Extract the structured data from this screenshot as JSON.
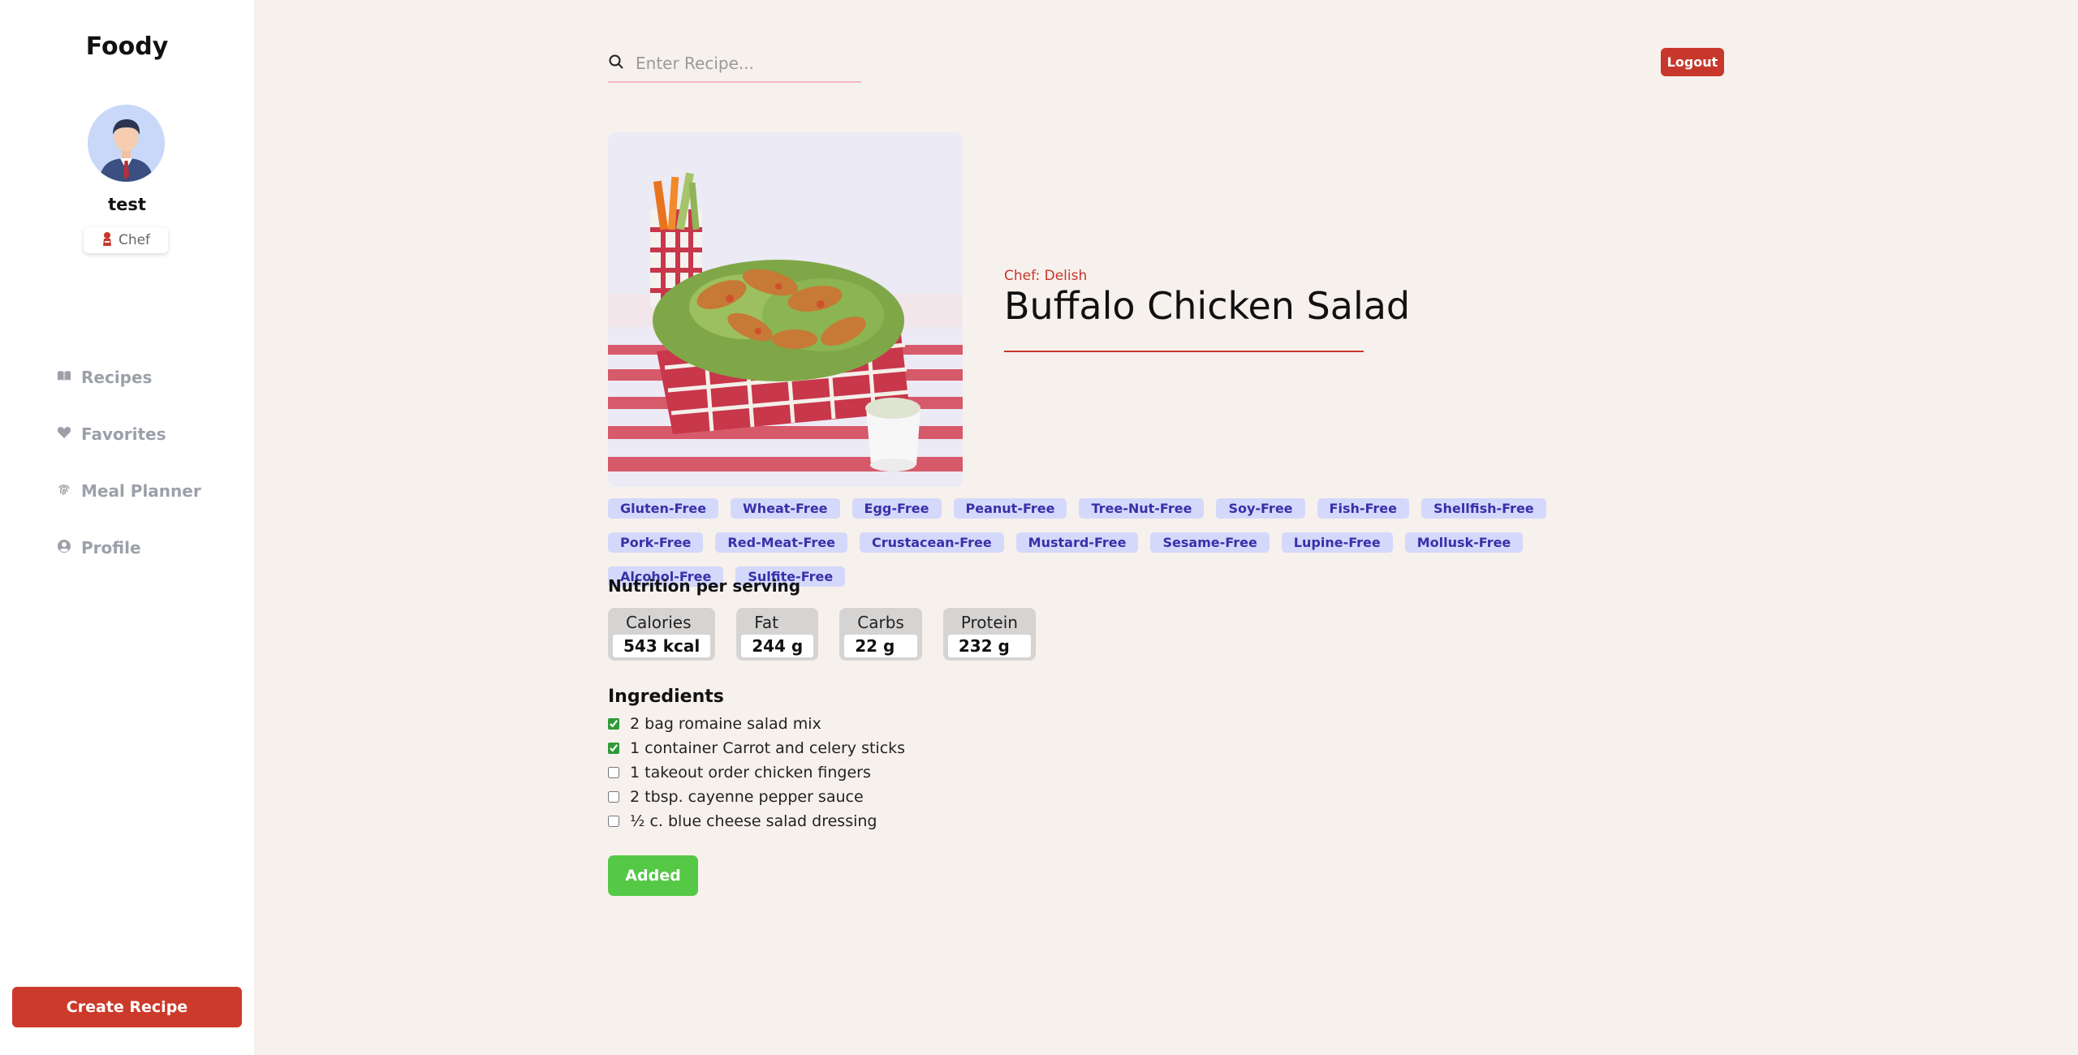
{
  "app": {
    "title": "Foody"
  },
  "user": {
    "name": "test",
    "role": "Chef"
  },
  "nav": {
    "items": [
      {
        "label": "Recipes",
        "icon": "book-icon"
      },
      {
        "label": "Favorites",
        "icon": "heart-icon"
      },
      {
        "label": "Meal Planner",
        "icon": "fingerprint-icon"
      },
      {
        "label": "Profile",
        "icon": "user-circle-icon"
      }
    ]
  },
  "sidebar": {
    "create_label": "Create Recipe"
  },
  "header": {
    "search_placeholder": "Enter Recipe...",
    "logout_label": "Logout"
  },
  "recipe": {
    "chef": "Chef: Delish",
    "title": "Buffalo Chicken Salad",
    "tags": [
      "Gluten-Free",
      "Wheat-Free",
      "Egg-Free",
      "Peanut-Free",
      "Tree-Nut-Free",
      "Soy-Free",
      "Fish-Free",
      "Shellfish-Free",
      "Pork-Free",
      "Red-Meat-Free",
      "Crustacean-Free",
      "Mustard-Free",
      "Sesame-Free",
      "Lupine-Free",
      "Mollusk-Free",
      "Alcohol-Free",
      "Sulfite-Free"
    ],
    "nutrition_heading": "Nutrition per serving",
    "nutrition": [
      {
        "label": "Calories",
        "value": "543 kcal"
      },
      {
        "label": "Fat",
        "value": "244 g"
      },
      {
        "label": "Carbs",
        "value": "22 g"
      },
      {
        "label": "Protein",
        "value": "232 g"
      }
    ],
    "ingredients_heading": "Ingredients",
    "ingredients": [
      {
        "text": "2 bag romaine salad mix",
        "checked": true
      },
      {
        "text": "1 container Carrot and celery sticks",
        "checked": true
      },
      {
        "text": "1 takeout order chicken fingers",
        "checked": false
      },
      {
        "text": "2 tbsp. cayenne pepper sauce",
        "checked": false
      },
      {
        "text": "½ c. blue cheese salad dressing",
        "checked": false
      }
    ],
    "added_label": "Added"
  },
  "colors": {
    "accent": "#c8372b",
    "tag_bg": "#d4d8fb",
    "tag_text": "#3731a8",
    "added": "#55c846",
    "background": "#f7f1ed"
  }
}
